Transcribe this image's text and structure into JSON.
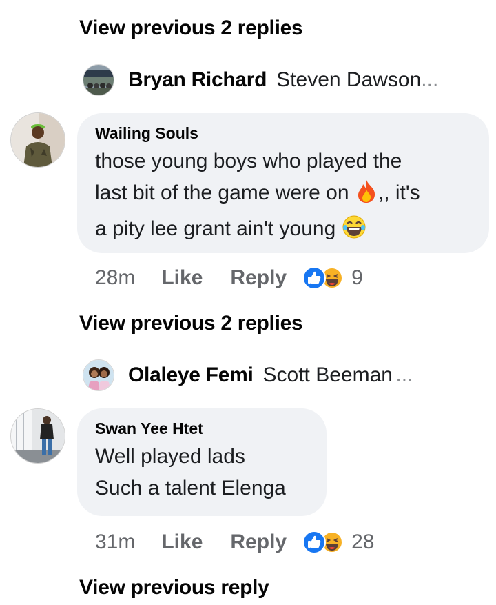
{
  "thread1": {
    "view_previous": "View previous 2 replies",
    "preview": {
      "name": "Bryan Richard",
      "text": "Steven Dawson",
      "ellipsis": "..."
    },
    "comment": {
      "author": "Wailing Souls",
      "line1": "those young boys who played the",
      "line2_pre": "last bit of the game were on",
      "line2_post": ",, it's",
      "line3": "a pity lee grant ain't young",
      "time": "28m",
      "like": "Like",
      "reply": "Reply",
      "reaction_count": "9"
    }
  },
  "thread2": {
    "view_previous": "View previous 2 replies",
    "preview": {
      "name": "Olaleye Femi",
      "text": "Scott Beeman",
      "ellipsis": "..."
    },
    "comment": {
      "author": "Swan Yee Htet",
      "line1": "Well played lads",
      "line2": "Such a talent Elenga",
      "time": "31m",
      "like": "Like",
      "reply": "Reply",
      "reaction_count": "28"
    }
  },
  "footer": {
    "view_previous": "View previous reply"
  },
  "colors": {
    "bubble": "#f0f2f5",
    "like_blue": "#1877f2",
    "haha_yellow": "#f7b125",
    "secondary_text": "#65676b"
  },
  "icons": [
    "like-reaction-icon",
    "haha-reaction-icon",
    "fire-emoji-icon",
    "laughing-emoji-icon"
  ]
}
